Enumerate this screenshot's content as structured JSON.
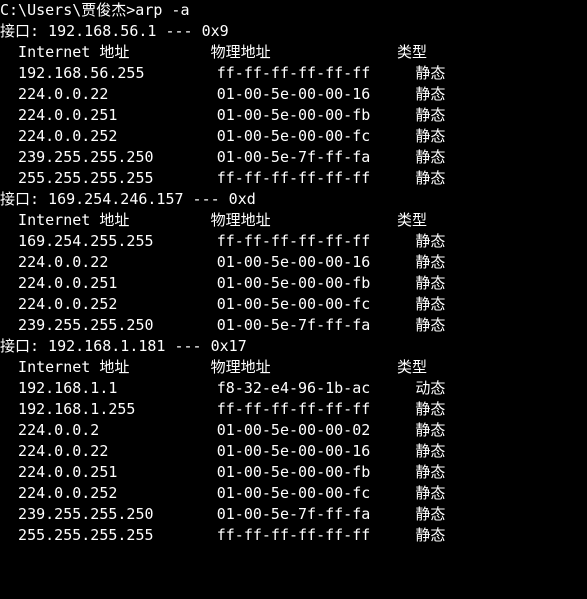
{
  "prompt": "C:\\Users\\贾俊杰>arp -a",
  "sections": [
    {
      "interface_line": "接口: 192.168.56.1 --- 0x9",
      "header": {
        "c1": "Internet 地址",
        "c2": "物理地址",
        "c3": "类型"
      },
      "rows": [
        {
          "ip": "192.168.56.255",
          "mac": "ff-ff-ff-ff-ff-ff",
          "type": "静态"
        },
        {
          "ip": "224.0.0.22",
          "mac": "01-00-5e-00-00-16",
          "type": "静态"
        },
        {
          "ip": "224.0.0.251",
          "mac": "01-00-5e-00-00-fb",
          "type": "静态"
        },
        {
          "ip": "224.0.0.252",
          "mac": "01-00-5e-00-00-fc",
          "type": "静态"
        },
        {
          "ip": "239.255.255.250",
          "mac": "01-00-5e-7f-ff-fa",
          "type": "静态"
        },
        {
          "ip": "255.255.255.255",
          "mac": "ff-ff-ff-ff-ff-ff",
          "type": "静态"
        }
      ]
    },
    {
      "interface_line": "接口: 169.254.246.157 --- 0xd",
      "header": {
        "c1": "Internet 地址",
        "c2": "物理地址",
        "c3": "类型"
      },
      "rows": [
        {
          "ip": "169.254.255.255",
          "mac": "ff-ff-ff-ff-ff-ff",
          "type": "静态"
        },
        {
          "ip": "224.0.0.22",
          "mac": "01-00-5e-00-00-16",
          "type": "静态"
        },
        {
          "ip": "224.0.0.251",
          "mac": "01-00-5e-00-00-fb",
          "type": "静态"
        },
        {
          "ip": "224.0.0.252",
          "mac": "01-00-5e-00-00-fc",
          "type": "静态"
        },
        {
          "ip": "239.255.255.250",
          "mac": "01-00-5e-7f-ff-fa",
          "type": "静态"
        }
      ]
    },
    {
      "interface_line": "接口: 192.168.1.181 --- 0x17",
      "header": {
        "c1": "Internet 地址",
        "c2": "物理地址",
        "c3": "类型"
      },
      "rows": [
        {
          "ip": "192.168.1.1",
          "mac": "f8-32-e4-96-1b-ac",
          "type": "动态"
        },
        {
          "ip": "192.168.1.255",
          "mac": "ff-ff-ff-ff-ff-ff",
          "type": "静态"
        },
        {
          "ip": "224.0.0.2",
          "mac": "01-00-5e-00-00-02",
          "type": "静态"
        },
        {
          "ip": "224.0.0.22",
          "mac": "01-00-5e-00-00-16",
          "type": "静态"
        },
        {
          "ip": "224.0.0.251",
          "mac": "01-00-5e-00-00-fb",
          "type": "静态"
        },
        {
          "ip": "224.0.0.252",
          "mac": "01-00-5e-00-00-fc",
          "type": "静态"
        },
        {
          "ip": "239.255.255.250",
          "mac": "01-00-5e-7f-ff-fa",
          "type": "静态"
        },
        {
          "ip": "255.255.255.255",
          "mac": "ff-ff-ff-ff-ff-ff",
          "type": "静态"
        }
      ]
    }
  ]
}
